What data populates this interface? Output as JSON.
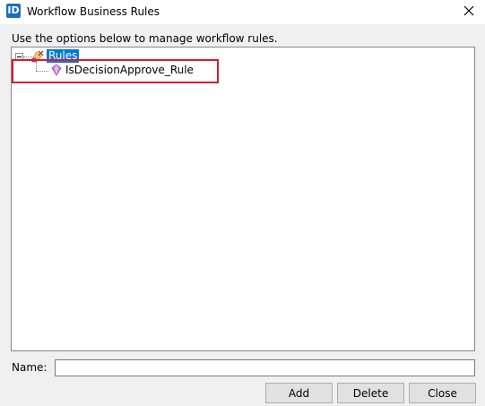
{
  "window": {
    "title": "Workflow Business Rules",
    "app_icon_text": "ID",
    "app_icon_color": "#1f6fb5"
  },
  "instruction_text": "Use the options below to manage workflow rules.",
  "tree": {
    "root": {
      "label": "Rules",
      "expanded": true,
      "selected": true,
      "icon": "rules-folder-icon"
    },
    "children": [
      {
        "label": "IsDecisionApprove_Rule",
        "icon": "rule-gem-icon"
      }
    ]
  },
  "highlight_color": "#e0182d",
  "selection_color": "#0078d7",
  "form": {
    "name_label": "Name:",
    "name_value": ""
  },
  "buttons": {
    "add": "Add",
    "delete": "Delete",
    "close": "Close"
  }
}
